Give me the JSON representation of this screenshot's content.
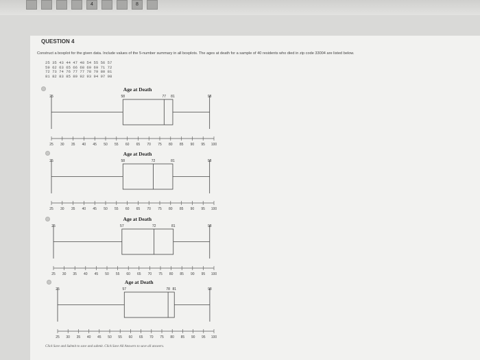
{
  "nav": {
    "question_numbers": [
      "4",
      "8"
    ]
  },
  "question": {
    "title": "QUESTION 4",
    "prompt": "Construct a boxplot for the given data. Include values of the 5-number summary in all boxplots. The ages at death for a sample of 40 residents who died in zip code 33004 are listed below.",
    "data_rows": [
      "25 35 43 44 47 48 54 55 56 57",
      "59 62 63 65 66 68 69 69 71 72",
      "72 73 74 76 77 77 78 79 80 81",
      "81 82 83 85 89 92 93 94 97 98"
    ]
  },
  "options": [
    {
      "title": "Age at Death",
      "five_number": [
        25,
        58,
        77,
        81,
        98
      ],
      "labels": [
        "25",
        "58",
        "77",
        "81",
        "98"
      ]
    },
    {
      "title": "Age at Death",
      "five_number": [
        25,
        58,
        72,
        81,
        98
      ],
      "labels": [
        "25",
        "58",
        "72",
        "81",
        "98"
      ]
    },
    {
      "title": "Age at Death",
      "five_number": [
        25,
        57,
        72,
        81,
        98
      ],
      "labels": [
        "25",
        "57",
        "72",
        "81",
        "98"
      ]
    },
    {
      "title": "Age at Death",
      "five_number": [
        25,
        57,
        78,
        81,
        98
      ],
      "labels": [
        "25",
        "57",
        "78",
        "81",
        "98"
      ]
    }
  ],
  "axis": {
    "ticks": [
      "25",
      "30",
      "35",
      "40",
      "45",
      "50",
      "55",
      "60",
      "65",
      "70",
      "75",
      "80",
      "85",
      "90",
      "95",
      "100"
    ]
  },
  "footer": {
    "text": "Click Save and Submit to save and submit. Click Save All Answers to save all answers."
  },
  "chart_data": [
    {
      "type": "boxplot",
      "title": "Age at Death",
      "min": 25,
      "q1": 58,
      "median": 77,
      "q3": 81,
      "max": 98,
      "xlim": [
        25,
        100
      ]
    },
    {
      "type": "boxplot",
      "title": "Age at Death",
      "min": 25,
      "q1": 58,
      "median": 72,
      "q3": 81,
      "max": 98,
      "xlim": [
        25,
        100
      ]
    },
    {
      "type": "boxplot",
      "title": "Age at Death",
      "min": 25,
      "q1": 57,
      "median": 72,
      "q3": 81,
      "max": 98,
      "xlim": [
        25,
        100
      ]
    },
    {
      "type": "boxplot",
      "title": "Age at Death",
      "min": 25,
      "q1": 57,
      "median": 78,
      "q3": 81,
      "max": 98,
      "xlim": [
        25,
        100
      ]
    }
  ]
}
